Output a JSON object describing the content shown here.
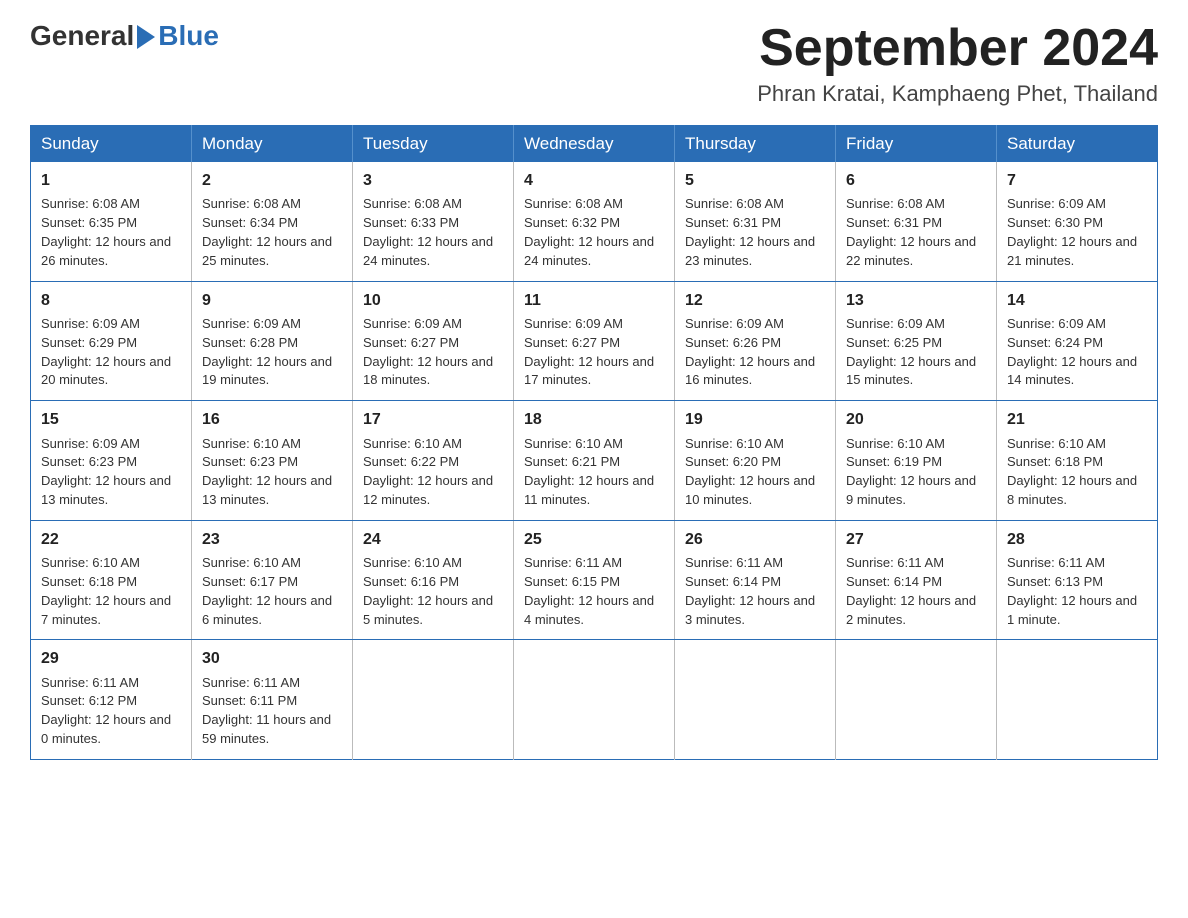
{
  "logo": {
    "general": "General",
    "blue": "Blue"
  },
  "title": {
    "month": "September 2024",
    "location": "Phran Kratai, Kamphaeng Phet, Thailand"
  },
  "headers": [
    "Sunday",
    "Monday",
    "Tuesday",
    "Wednesday",
    "Thursday",
    "Friday",
    "Saturday"
  ],
  "weeks": [
    [
      {
        "day": "1",
        "sunrise": "6:08 AM",
        "sunset": "6:35 PM",
        "daylight": "12 hours and 26 minutes."
      },
      {
        "day": "2",
        "sunrise": "6:08 AM",
        "sunset": "6:34 PM",
        "daylight": "12 hours and 25 minutes."
      },
      {
        "day": "3",
        "sunrise": "6:08 AM",
        "sunset": "6:33 PM",
        "daylight": "12 hours and 24 minutes."
      },
      {
        "day": "4",
        "sunrise": "6:08 AM",
        "sunset": "6:32 PM",
        "daylight": "12 hours and 24 minutes."
      },
      {
        "day": "5",
        "sunrise": "6:08 AM",
        "sunset": "6:31 PM",
        "daylight": "12 hours and 23 minutes."
      },
      {
        "day": "6",
        "sunrise": "6:08 AM",
        "sunset": "6:31 PM",
        "daylight": "12 hours and 22 minutes."
      },
      {
        "day": "7",
        "sunrise": "6:09 AM",
        "sunset": "6:30 PM",
        "daylight": "12 hours and 21 minutes."
      }
    ],
    [
      {
        "day": "8",
        "sunrise": "6:09 AM",
        "sunset": "6:29 PM",
        "daylight": "12 hours and 20 minutes."
      },
      {
        "day": "9",
        "sunrise": "6:09 AM",
        "sunset": "6:28 PM",
        "daylight": "12 hours and 19 minutes."
      },
      {
        "day": "10",
        "sunrise": "6:09 AM",
        "sunset": "6:27 PM",
        "daylight": "12 hours and 18 minutes."
      },
      {
        "day": "11",
        "sunrise": "6:09 AM",
        "sunset": "6:27 PM",
        "daylight": "12 hours and 17 minutes."
      },
      {
        "day": "12",
        "sunrise": "6:09 AM",
        "sunset": "6:26 PM",
        "daylight": "12 hours and 16 minutes."
      },
      {
        "day": "13",
        "sunrise": "6:09 AM",
        "sunset": "6:25 PM",
        "daylight": "12 hours and 15 minutes."
      },
      {
        "day": "14",
        "sunrise": "6:09 AM",
        "sunset": "6:24 PM",
        "daylight": "12 hours and 14 minutes."
      }
    ],
    [
      {
        "day": "15",
        "sunrise": "6:09 AM",
        "sunset": "6:23 PM",
        "daylight": "12 hours and 13 minutes."
      },
      {
        "day": "16",
        "sunrise": "6:10 AM",
        "sunset": "6:23 PM",
        "daylight": "12 hours and 13 minutes."
      },
      {
        "day": "17",
        "sunrise": "6:10 AM",
        "sunset": "6:22 PM",
        "daylight": "12 hours and 12 minutes."
      },
      {
        "day": "18",
        "sunrise": "6:10 AM",
        "sunset": "6:21 PM",
        "daylight": "12 hours and 11 minutes."
      },
      {
        "day": "19",
        "sunrise": "6:10 AM",
        "sunset": "6:20 PM",
        "daylight": "12 hours and 10 minutes."
      },
      {
        "day": "20",
        "sunrise": "6:10 AM",
        "sunset": "6:19 PM",
        "daylight": "12 hours and 9 minutes."
      },
      {
        "day": "21",
        "sunrise": "6:10 AM",
        "sunset": "6:18 PM",
        "daylight": "12 hours and 8 minutes."
      }
    ],
    [
      {
        "day": "22",
        "sunrise": "6:10 AM",
        "sunset": "6:18 PM",
        "daylight": "12 hours and 7 minutes."
      },
      {
        "day": "23",
        "sunrise": "6:10 AM",
        "sunset": "6:17 PM",
        "daylight": "12 hours and 6 minutes."
      },
      {
        "day": "24",
        "sunrise": "6:10 AM",
        "sunset": "6:16 PM",
        "daylight": "12 hours and 5 minutes."
      },
      {
        "day": "25",
        "sunrise": "6:11 AM",
        "sunset": "6:15 PM",
        "daylight": "12 hours and 4 minutes."
      },
      {
        "day": "26",
        "sunrise": "6:11 AM",
        "sunset": "6:14 PM",
        "daylight": "12 hours and 3 minutes."
      },
      {
        "day": "27",
        "sunrise": "6:11 AM",
        "sunset": "6:14 PM",
        "daylight": "12 hours and 2 minutes."
      },
      {
        "day": "28",
        "sunrise": "6:11 AM",
        "sunset": "6:13 PM",
        "daylight": "12 hours and 1 minute."
      }
    ],
    [
      {
        "day": "29",
        "sunrise": "6:11 AM",
        "sunset": "6:12 PM",
        "daylight": "12 hours and 0 minutes."
      },
      {
        "day": "30",
        "sunrise": "6:11 AM",
        "sunset": "6:11 PM",
        "daylight": "11 hours and 59 minutes."
      },
      null,
      null,
      null,
      null,
      null
    ]
  ]
}
